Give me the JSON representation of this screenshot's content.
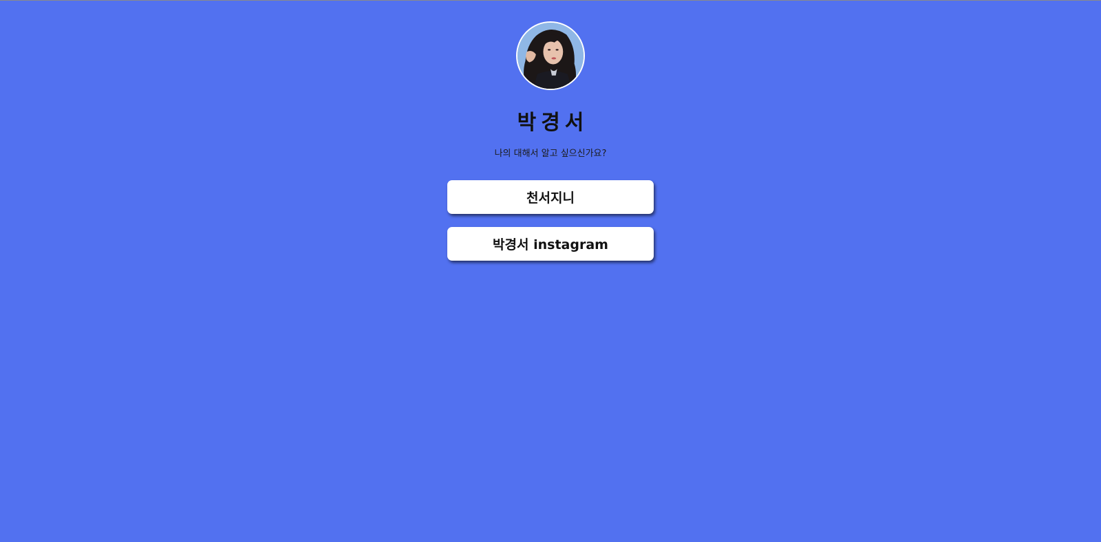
{
  "profile": {
    "name": "박경서",
    "tagline": "나의 대해서 알고 싶으신가요?",
    "avatar_icon": "profile-photo"
  },
  "links": [
    {
      "label": "천서지니"
    },
    {
      "label": "박경서 instagram"
    }
  ],
  "colors": {
    "background": "#5271f0",
    "button": "#ffffff",
    "text": "#111111"
  }
}
